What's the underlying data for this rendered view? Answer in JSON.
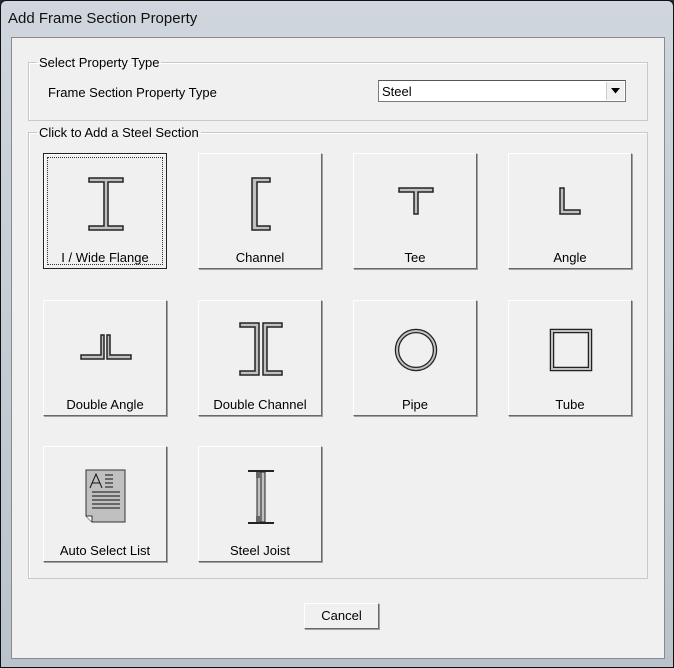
{
  "window": {
    "title": "Add Frame Section Property"
  },
  "property_type_group": {
    "legend": "Select Property Type",
    "label": "Frame Section Property Type",
    "selected": "Steel"
  },
  "sections_group": {
    "legend": "Click to Add a Steel Section",
    "buttons": [
      {
        "label": "I / Wide Flange",
        "icon": "i-beam-icon"
      },
      {
        "label": "Channel",
        "icon": "channel-icon"
      },
      {
        "label": "Tee",
        "icon": "tee-icon"
      },
      {
        "label": "Angle",
        "icon": "angle-icon"
      },
      {
        "label": "Double Angle",
        "icon": "double-angle-icon"
      },
      {
        "label": "Double Channel",
        "icon": "double-channel-icon"
      },
      {
        "label": "Pipe",
        "icon": "pipe-icon"
      },
      {
        "label": "Tube",
        "icon": "tube-icon"
      },
      {
        "label": "Auto Select List",
        "icon": "document-list-icon"
      },
      {
        "label": "Steel Joist",
        "icon": "steel-joist-icon"
      }
    ]
  },
  "footer": {
    "cancel_label": "Cancel"
  },
  "colors": {
    "section_fill": "#c0c0c0",
    "dialog_bg": "#f0f0f0"
  }
}
